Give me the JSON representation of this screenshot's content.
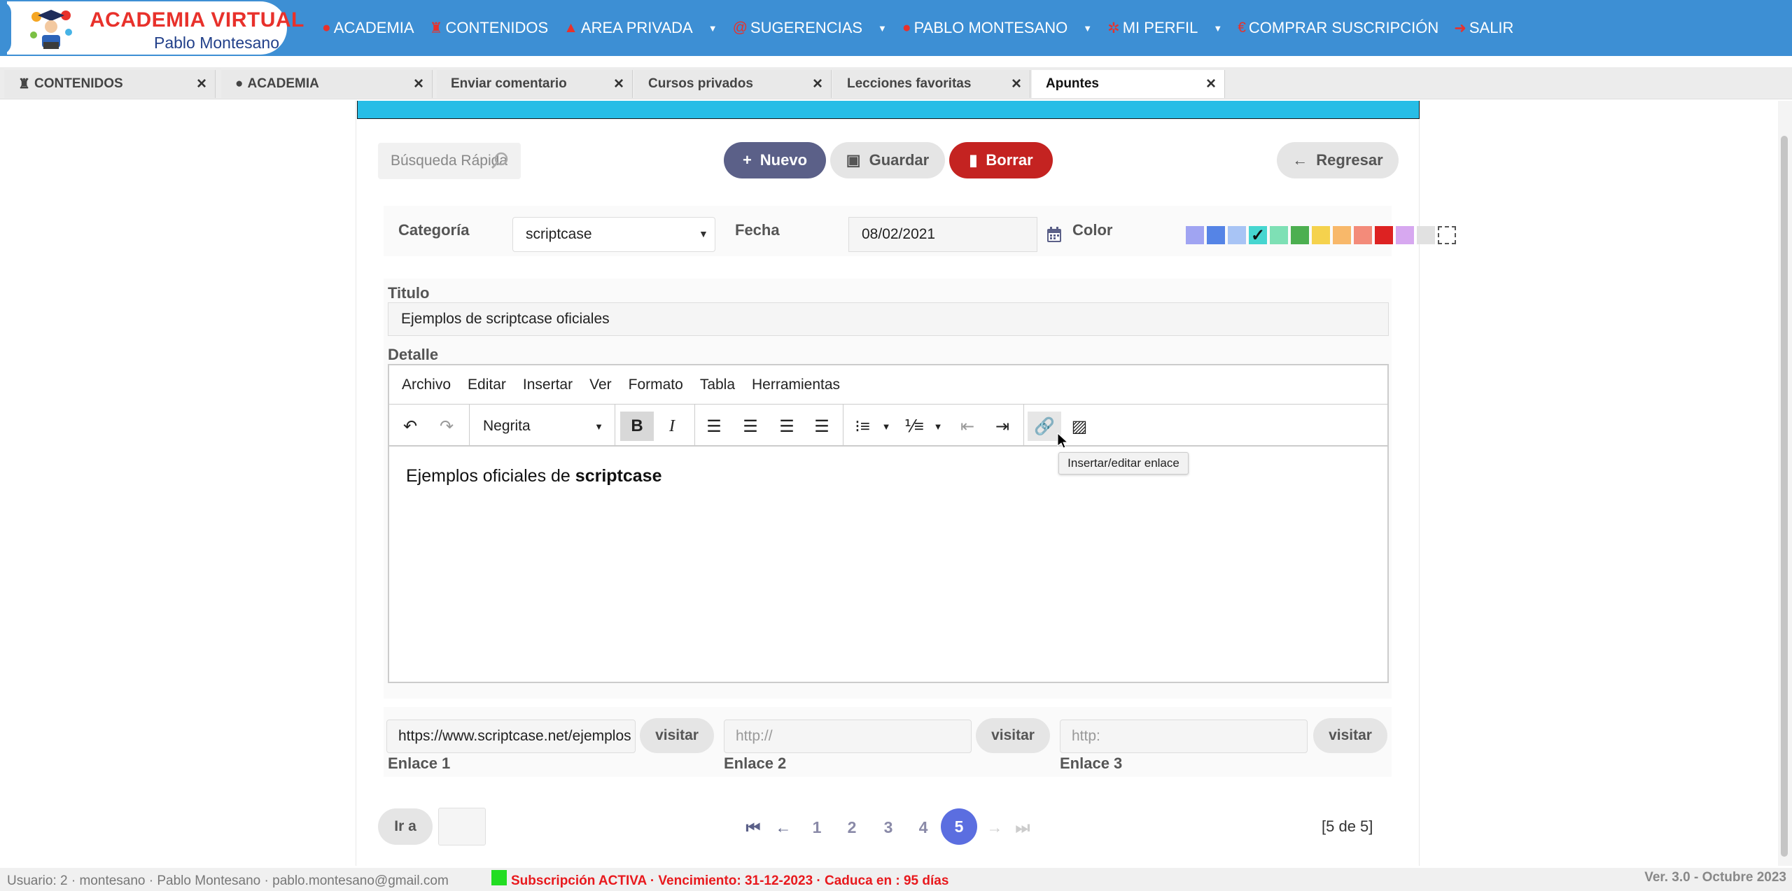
{
  "brand": {
    "title": "ACADEMIA VIRTUAL",
    "subtitle": "Pablo Montesano"
  },
  "menu": [
    {
      "label": "ACADEMIA",
      "icon": "globe-icon",
      "has_dropdown": false
    },
    {
      "label": "CONTENIDOS",
      "icon": "flask-icon",
      "has_dropdown": false
    },
    {
      "label": "AREA PRIVADA",
      "icon": "user-tie-icon",
      "has_dropdown": true
    },
    {
      "label": "SUGERENCIAS",
      "icon": "at-icon",
      "has_dropdown": true
    },
    {
      "label": "PABLO MONTESANO",
      "icon": "user-icon",
      "has_dropdown": true
    },
    {
      "label": "MI PERFIL",
      "icon": "gears-icon",
      "has_dropdown": true
    },
    {
      "label": "COMPRAR SUSCRIPCIÓN",
      "icon": "euro-icon",
      "has_dropdown": false
    },
    {
      "label": "SALIR",
      "icon": "sign-out-icon",
      "has_dropdown": false
    }
  ],
  "tabs": [
    {
      "label": "CONTENIDOS",
      "icon": "flask-icon",
      "active": false
    },
    {
      "label": "ACADEMIA",
      "icon": "globe-icon",
      "active": false
    },
    {
      "label": "Enviar comentario",
      "active": false
    },
    {
      "label": "Cursos privados",
      "active": false
    },
    {
      "label": "Lecciones favoritas",
      "active": false
    },
    {
      "label": "Apuntes",
      "active": true
    }
  ],
  "toolbar": {
    "search_placeholder": "Búsqueda Rápida",
    "new_label": "Nuevo",
    "save_label": "Guardar",
    "delete_label": "Borrar",
    "back_label": "Regresar"
  },
  "form": {
    "category_label": "Categoría",
    "category_value": "scriptcase",
    "date_label": "Fecha",
    "date_value": "08/02/2021",
    "color_label": "Color",
    "colors": [
      "#a0a4f2",
      "#5584e6",
      "#a8c4f5",
      "#46d6d0",
      "#7ee0b5",
      "#4caf50",
      "#f5d24d",
      "#f8b86a",
      "#f38b7a",
      "#dd2222",
      "#d7a8f0",
      "#e1e1e1",
      "#ffffff"
    ],
    "selected_color_index": 3,
    "title_label": "Titulo",
    "title_value": "Ejemplos de scriptcase oficiales",
    "detail_label": "Detalle"
  },
  "editor": {
    "menus": [
      "Archivo",
      "Editar",
      "Insertar",
      "Ver",
      "Formato",
      "Tabla",
      "Herramientas"
    ],
    "block_format": "Negrita",
    "content_plain": "Ejemplos oficiales de ",
    "content_bold": "scriptcase",
    "tooltip": "Insertar/editar enlace"
  },
  "links": [
    {
      "label": "Enlace 1",
      "value": "https://www.scriptcase.net/ejemplos",
      "placeholder": "",
      "button": "visitar"
    },
    {
      "label": "Enlace 2",
      "value": "",
      "placeholder": "http://",
      "button": "visitar"
    },
    {
      "label": "Enlace 3",
      "value": "",
      "placeholder": "http:",
      "button": "visitar"
    }
  ],
  "pagination": {
    "goto_label": "Ir a",
    "pages": [
      "1",
      "2",
      "3",
      "4",
      "5"
    ],
    "current": "5",
    "count": "[5 de 5]"
  },
  "footer": {
    "user": "Usuario: 2 · montesano · Pablo Montesano · pablo.montesano@gmail.com",
    "subscription": "Subscripción ACTIVA · Vencimiento: 31-12-2023 · Caduca en : 95 días",
    "version": "Ver. 3.0 - Octubre 2023",
    "status_color": "#22dd22"
  },
  "colors": {
    "topbar": "#3d8fd4",
    "accent_red": "#e8312b",
    "strip": "#27bde6",
    "primary_btn": "#5b6088",
    "danger_btn": "#c42321"
  }
}
